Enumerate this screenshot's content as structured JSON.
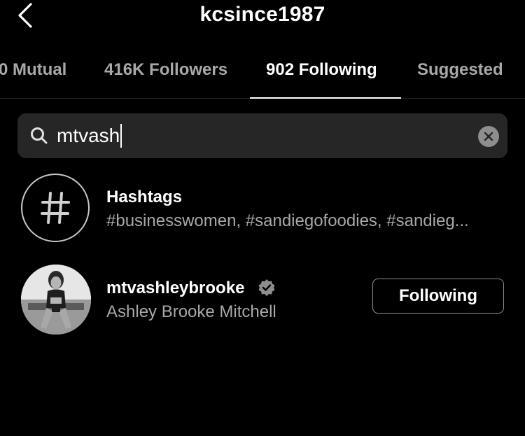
{
  "header": {
    "title": "kcsince1987",
    "back_icon": "chevron-left-icon"
  },
  "tabs": [
    {
      "label": "0 Mutual",
      "active": false
    },
    {
      "label": "416K Followers",
      "active": false
    },
    {
      "label": "902 Following",
      "active": true
    },
    {
      "label": "Suggested",
      "active": false
    }
  ],
  "search": {
    "value": "mtvash",
    "icon": "search-icon",
    "clear_icon": "clear-icon"
  },
  "results": {
    "hashtags": {
      "title": "Hashtags",
      "subtitle": "#businesswomen, #sandiegofoodies, #sandieg...",
      "icon": "hashtag-icon"
    },
    "user": {
      "username": "mtvashleybrooke",
      "full_name": "Ashley Brooke Mitchell",
      "verified": true,
      "button_label": "Following"
    }
  },
  "colors": {
    "background": "#000000",
    "text_primary": "#ffffff",
    "text_secondary": "#a8a8a8",
    "search_bg": "#262626"
  }
}
